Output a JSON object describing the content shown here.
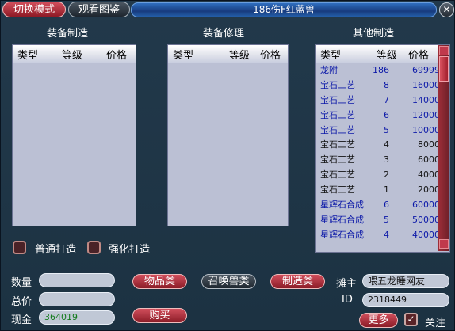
{
  "title_bar": {
    "switch_mode": "切换模式",
    "view_guide": "观看图鉴",
    "title": "186伤F红蓝兽",
    "close": "✕"
  },
  "sections": {
    "equip_make": "装备制造",
    "equip_repair": "装备修理",
    "other_make": "其他制造"
  },
  "columns": {
    "type": "类型",
    "level": "等级",
    "price": "价格"
  },
  "other_rows": [
    {
      "type": "龙附",
      "level": "186",
      "price": "69999",
      "color": "blue"
    },
    {
      "type": "宝石工艺",
      "level": "8",
      "price": "16000",
      "color": "blue"
    },
    {
      "type": "宝石工艺",
      "level": "7",
      "price": "14000",
      "color": "blue"
    },
    {
      "type": "宝石工艺",
      "level": "6",
      "price": "12000",
      "color": "blue"
    },
    {
      "type": "宝石工艺",
      "level": "5",
      "price": "10000",
      "color": "blue"
    },
    {
      "type": "宝石工艺",
      "level": "4",
      "price": "8000",
      "color": "black"
    },
    {
      "type": "宝石工艺",
      "level": "3",
      "price": "6000",
      "color": "black"
    },
    {
      "type": "宝石工艺",
      "level": "2",
      "price": "4000",
      "color": "black"
    },
    {
      "type": "宝石工艺",
      "level": "1",
      "price": "2000",
      "color": "black"
    },
    {
      "type": "星辉石合成",
      "level": "6",
      "price": "60000",
      "color": "blue"
    },
    {
      "type": "星辉石合成",
      "level": "5",
      "price": "50000",
      "color": "blue"
    },
    {
      "type": "星辉石合成",
      "level": "4",
      "price": "40000",
      "color": "blue"
    }
  ],
  "checkboxes": {
    "normal_forge": "普通打造",
    "strong_forge": "强化打造"
  },
  "form": {
    "quantity_label": "数量",
    "quantity_value": "",
    "total_label": "总价",
    "total_value": "",
    "cash_label": "现金",
    "cash_value": "364019"
  },
  "buttons": {
    "items": "物品类",
    "summon": "召唤兽类",
    "craft": "制造类",
    "buy": "购买",
    "more": "更多"
  },
  "stall": {
    "owner_label": "摊主",
    "owner_value": "喂五龙睡网友",
    "id_label": "ID",
    "id_value": "2318449",
    "follow_label": "关注",
    "follow_check": "✓"
  },
  "colors": {
    "blue_text": "#0b18a8",
    "cash_text": "#137b1c"
  }
}
